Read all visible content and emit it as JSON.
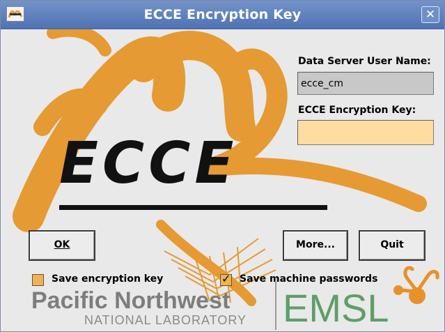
{
  "window": {
    "title": "ECCE Encryption Key"
  },
  "form": {
    "user_label": "Data Server User Name:",
    "user_value": "ecce_cm",
    "key_label": "ECCE Encryption Key:",
    "key_value": ""
  },
  "buttons": {
    "ok": "OK",
    "more": "More...",
    "quit": "Quit"
  },
  "checkboxes": {
    "save_key": {
      "label": "Save encryption key",
      "checked": false
    },
    "save_passwords": {
      "label": "Save machine passwords",
      "checked": true
    }
  },
  "branding": {
    "ecce_logo": "ECCE",
    "org_line1": "Pacific Northwest",
    "org_line2": "NATIONAL LABORATORY",
    "emsl": "EMSL"
  },
  "colors": {
    "accent_orange": "#e59a33",
    "titlebar_blue": "#5b7dbb",
    "key_field": "#ffdca0",
    "emsl_green": "#5e9e68",
    "pnnl_gray": "#7d7d7d"
  },
  "icons": {
    "app": "ecce-app-icon",
    "close": "close-icon",
    "emsl_molecule": "molecule-icon"
  }
}
